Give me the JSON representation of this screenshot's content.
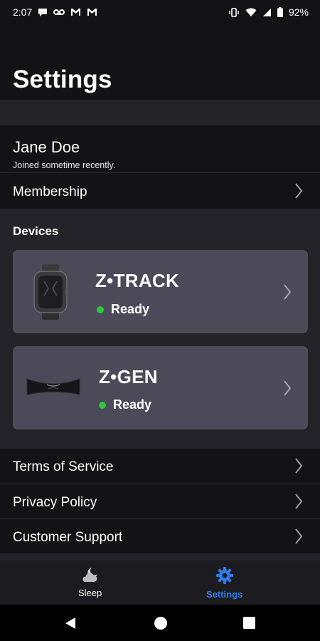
{
  "status_bar": {
    "time": "2:07",
    "battery": "92%",
    "left_icons": [
      "chat-bubble-icon",
      "voicemail-icon",
      "gmail-icon",
      "gmail-icon"
    ],
    "right_icons": [
      "vibrate-icon",
      "wifi-icon",
      "signal-icon",
      "battery-icon"
    ]
  },
  "page": {
    "title": "Settings"
  },
  "profile": {
    "name": "Jane Doe",
    "subtitle": "Joined sometime recently."
  },
  "membership": {
    "label": "Membership"
  },
  "devices": {
    "title": "Devices",
    "items": [
      {
        "name": "Z•TRACK",
        "status": "Ready",
        "status_color": "#29c93b"
      },
      {
        "name": "Z•GEN",
        "status": "Ready",
        "status_color": "#29c93b"
      }
    ]
  },
  "links": [
    {
      "label": "Terms of Service"
    },
    {
      "label": "Privacy Policy"
    },
    {
      "label": "Customer Support"
    }
  ],
  "bottom_nav": {
    "items": [
      {
        "label": "Sleep",
        "icon": "cloud-moon-icon",
        "active": false
      },
      {
        "label": "Settings",
        "icon": "gear-icon",
        "active": true
      }
    ],
    "active_color": "#2e7cf0"
  },
  "system_nav": {
    "buttons": [
      "back-icon",
      "home-icon",
      "recents-icon"
    ]
  },
  "colors": {
    "background": "#131316",
    "section": "#232329",
    "card": "#4c4a58",
    "accent": "#2e7cf0"
  }
}
